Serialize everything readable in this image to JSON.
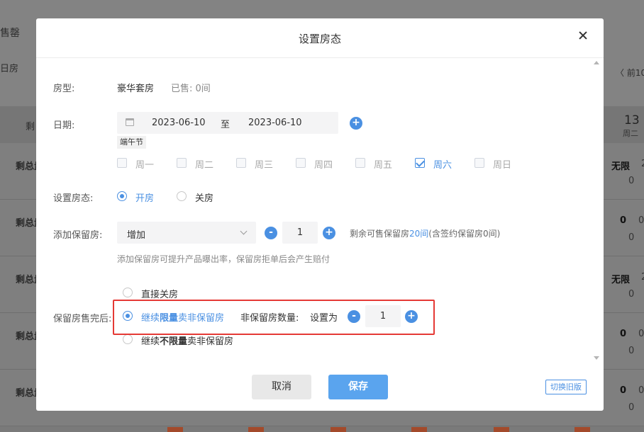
{
  "background": {
    "title_fragment": "售罄",
    "tab_fragment": "日房",
    "prev_fragment": "〈 前10",
    "header_remaining": "剩",
    "date_day": "13",
    "date_week": "周二",
    "rows": [
      {
        "label": "剩总量",
        "value": "无限",
        "sub": "0",
        "sep": "2"
      },
      {
        "label": "剩总量",
        "value": "0",
        "sub": "0",
        "sep": "0"
      },
      {
        "label": "剩总量",
        "value": "无限",
        "sub": "0",
        "sep": "2"
      },
      {
        "label": "剩总量",
        "value": "0",
        "sub": "0",
        "sep": "0"
      },
      {
        "label": "剩总量",
        "value": "0",
        "sub": "0",
        "sep": "0"
      }
    ]
  },
  "modal": {
    "title": "设置房态",
    "room_type_label": "房型:",
    "room_type_value": "豪华套房",
    "sold_text": "已售: 0间",
    "date_label": "日期:",
    "date_start": "2023-06-10",
    "date_to": "至",
    "date_end": "2023-06-10",
    "holiday_tag": "端午节",
    "weekdays": [
      {
        "label": "周一",
        "checked": false
      },
      {
        "label": "周二",
        "checked": false
      },
      {
        "label": "周三",
        "checked": false
      },
      {
        "label": "周四",
        "checked": false
      },
      {
        "label": "周五",
        "checked": false
      },
      {
        "label": "周六",
        "checked": true
      },
      {
        "label": "周日",
        "checked": false
      }
    ],
    "status_label": "设置房态:",
    "status_open": "开房",
    "status_close": "关房",
    "reserve_label": "添加保留房:",
    "reserve_select": "增加",
    "reserve_qty": "1",
    "reserve_info_prefix": "剩余可售保留房",
    "reserve_info_count": "20间",
    "reserve_info_suffix": "(含签约保留房0间)",
    "reserve_hint": "添加保留房可提升产品曝出率，保留房拒单后会产生赔付",
    "after_label": "保留房售完后:",
    "after_opt1": "直接关房",
    "after_opt2_a": "继续",
    "after_opt2_b": "限量",
    "after_opt2_c": "卖非保留房",
    "nonreserve_label": "非保留房数量:",
    "set_as": "设置为",
    "nonreserve_qty": "1",
    "after_opt3_a": "继续",
    "after_opt3_b": "不限量",
    "after_opt3_c": "卖非保留房",
    "cancel": "取消",
    "save": "保存",
    "switch_old": "切换旧版",
    "plus": "+",
    "minus": "-"
  }
}
